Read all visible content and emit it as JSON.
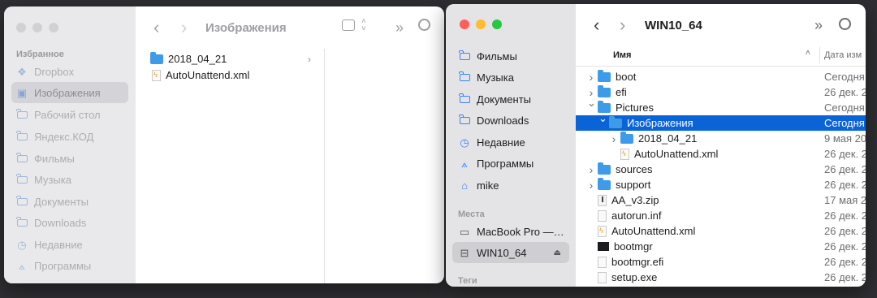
{
  "window1": {
    "title": "Изображения",
    "sidebar": {
      "section_favorites": "Избранное",
      "items": [
        {
          "label": "Dropbox",
          "icon": "dropbox-icon"
        },
        {
          "label": "Изображения",
          "icon": "image-icon",
          "selected": true
        },
        {
          "label": "Рабочий стол",
          "icon": "folder-icon"
        },
        {
          "label": "Яндекс.КОД",
          "icon": "folder-icon"
        },
        {
          "label": "Фильмы",
          "icon": "folder-icon"
        },
        {
          "label": "Музыка",
          "icon": "folder-icon"
        },
        {
          "label": "Документы",
          "icon": "folder-icon"
        },
        {
          "label": "Downloads",
          "icon": "folder-icon"
        },
        {
          "label": "Недавние",
          "icon": "clock-icon"
        },
        {
          "label": "Программы",
          "icon": "apps-icon"
        }
      ]
    },
    "files": [
      {
        "name": "2018_04_21",
        "type": "folder"
      },
      {
        "name": "AutoUnattend.xml",
        "type": "xml"
      }
    ]
  },
  "window2": {
    "title": "WIN10_64",
    "sidebar": {
      "favorites": [
        {
          "label": "Фильмы",
          "icon": "folder-icon"
        },
        {
          "label": "Музыка",
          "icon": "folder-icon"
        },
        {
          "label": "Документы",
          "icon": "folder-icon"
        },
        {
          "label": "Downloads",
          "icon": "folder-icon"
        },
        {
          "label": "Недавние",
          "icon": "clock-icon"
        },
        {
          "label": "Программы",
          "icon": "apps-icon"
        },
        {
          "label": "mike",
          "icon": "home-icon"
        }
      ],
      "section_places": "Места",
      "places": [
        {
          "label": "MacBook Pro —…",
          "icon": "laptop-icon"
        },
        {
          "label": "WIN10_64",
          "icon": "drive-icon",
          "selected": true
        }
      ],
      "section_tags": "Теги"
    },
    "columns": {
      "name": "Имя",
      "date": "Дата изм"
    },
    "rows": [
      {
        "name": "boot",
        "date": "Сегодня",
        "type": "folder",
        "level": 0,
        "disclosure": "closed"
      },
      {
        "name": "efi",
        "date": "26 дек. 2",
        "type": "folder",
        "level": 0,
        "disclosure": "closed"
      },
      {
        "name": "Pictures",
        "date": "Сегодня",
        "type": "folder",
        "level": 0,
        "disclosure": "open"
      },
      {
        "name": "Изображения",
        "date": "Сегодня",
        "type": "folder",
        "level": 1,
        "disclosure": "open",
        "selected": true
      },
      {
        "name": "2018_04_21",
        "date": "9 мая 20",
        "type": "folder",
        "level": 2,
        "disclosure": "closed"
      },
      {
        "name": "AutoUnattend.xml",
        "date": "26 дек. 2",
        "type": "xml",
        "level": 2,
        "disclosure": ""
      },
      {
        "name": "sources",
        "date": "26 дек. 2",
        "type": "folder",
        "level": 0,
        "disclosure": "closed"
      },
      {
        "name": "support",
        "date": "26 дек. 2",
        "type": "folder",
        "level": 0,
        "disclosure": "closed"
      },
      {
        "name": "AA_v3.zip",
        "date": "17 мая 2",
        "type": "zip",
        "level": 0,
        "disclosure": ""
      },
      {
        "name": "autorun.inf",
        "date": "26 дек. 2",
        "type": "doc",
        "level": 0,
        "disclosure": ""
      },
      {
        "name": "AutoUnattend.xml",
        "date": "26 дек. 2",
        "type": "xml",
        "level": 0,
        "disclosure": ""
      },
      {
        "name": "bootmgr",
        "date": "26 дек. 2",
        "type": "exec",
        "level": 0,
        "disclosure": ""
      },
      {
        "name": "bootmgr.efi",
        "date": "26 дек. 2",
        "type": "doc",
        "level": 0,
        "disclosure": ""
      },
      {
        "name": "setup.exe",
        "date": "26 дек. 2",
        "type": "doc",
        "level": 0,
        "disclosure": ""
      }
    ]
  },
  "colors": {
    "accent": "#0a64d8",
    "folder": "#3d9be9",
    "red": "#fe5f57",
    "yellow": "#febc2e",
    "green": "#28c840"
  }
}
